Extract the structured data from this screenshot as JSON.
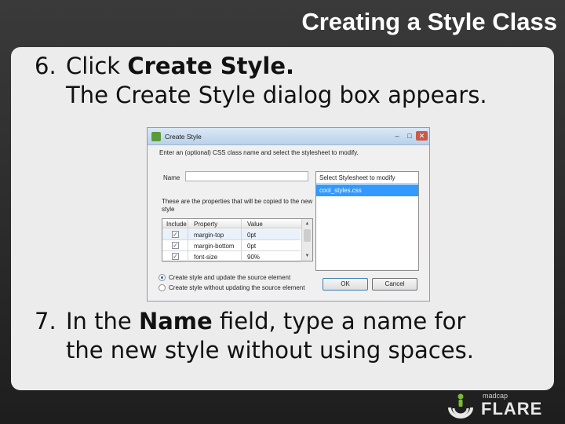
{
  "slide": {
    "title": "Creating a Style Class"
  },
  "steps": [
    {
      "number": "6.",
      "line1_prefix": "Click ",
      "line1_bold": "Create Style.",
      "line2": "The Create Style dialog box appears."
    },
    {
      "number": "7.",
      "line1_prefix": "In the ",
      "line1_bold": "Name",
      "line1_suffix": " field, type a name for",
      "line2": "the new style without using spaces."
    }
  ],
  "dialog": {
    "title": "Create Style",
    "window_controls": {
      "minimize": "–",
      "maximize": "□",
      "close": "✕"
    },
    "instructions": "Enter an (optional) CSS class name and select the stylesheet to modify.",
    "name_label": "Name",
    "name_value": "",
    "props_label": "These are the properties that will be copied to the new style",
    "columns": [
      "Include",
      "Property",
      "Value"
    ],
    "rows": [
      {
        "checked": true,
        "property": "margin-top",
        "value": "0pt"
      },
      {
        "checked": true,
        "property": "margin-bottom",
        "value": "0pt"
      },
      {
        "checked": true,
        "property": "font-size",
        "value": "90%"
      }
    ],
    "stylesheet_header": "Select Stylesheet to modify",
    "stylesheet_item": "cool_styles.css",
    "radio_options": [
      {
        "label": "Create style and update the source element",
        "selected": true
      },
      {
        "label": "Create style without updating the source element",
        "selected": false
      }
    ],
    "ok_label": "OK",
    "cancel_label": "Cancel"
  },
  "logo": {
    "small_text": "madcap",
    "big_text": "FLARE",
    "icon": "flare-logo-icon"
  }
}
